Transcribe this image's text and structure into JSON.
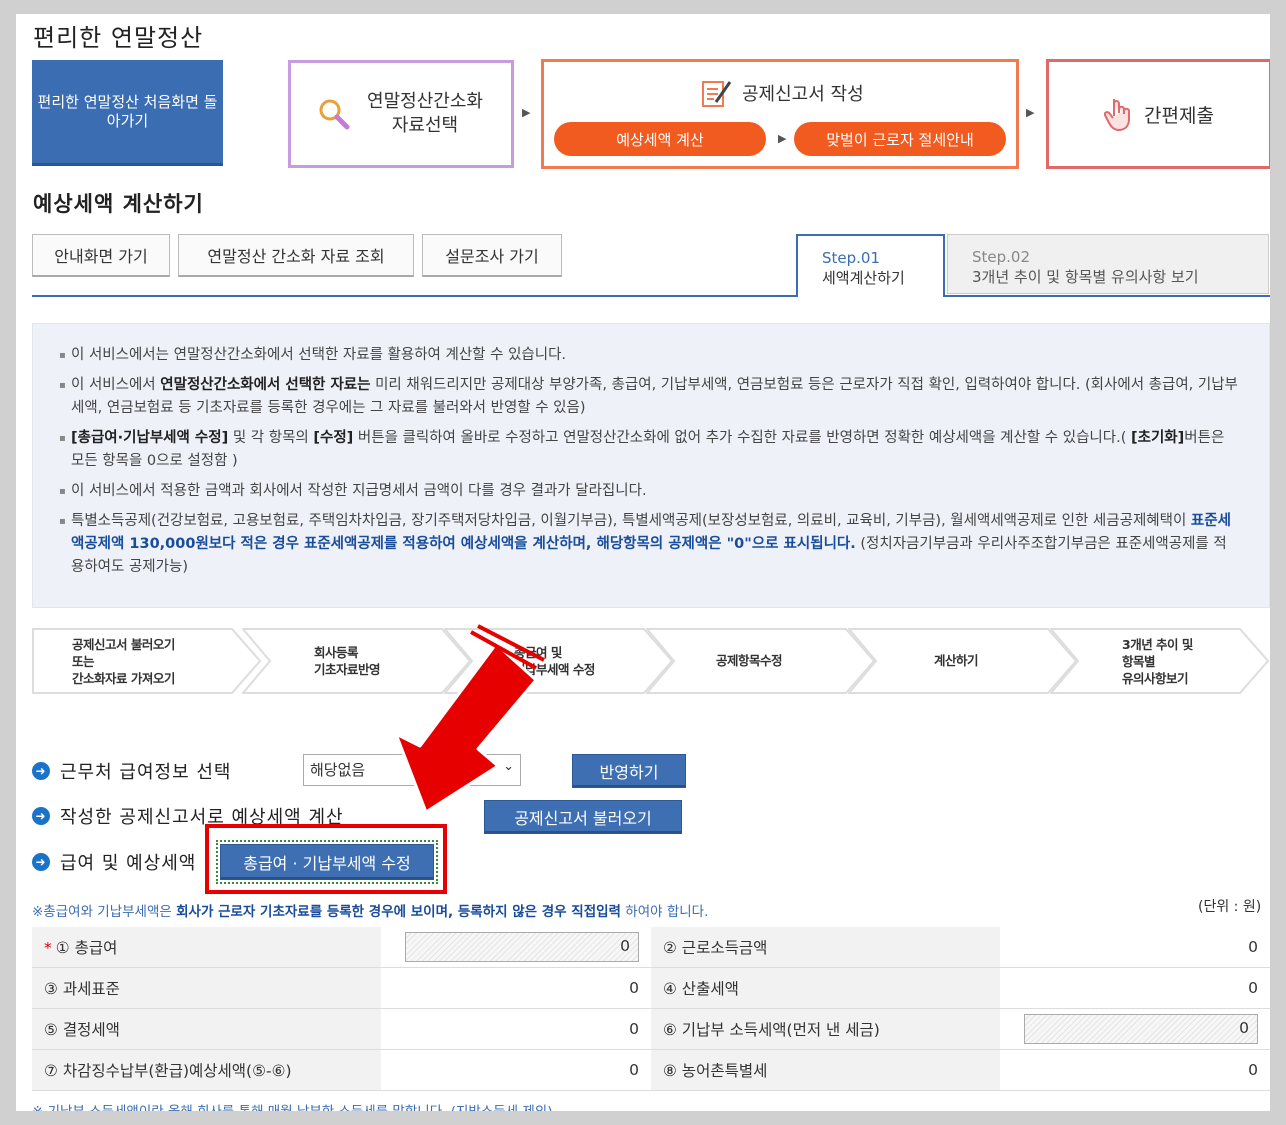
{
  "page": {
    "title": "편리한 연말정산"
  },
  "header": {
    "home_button": "편리한 연말정산 처음화면 돌아가기",
    "step1_label": "연말정산간소화 자료선택",
    "step2_label": "공제신고서 작성",
    "step2_sub1": "예상세액 계산",
    "step2_sub2": "맞벌이 근로자 절세안내",
    "step3_label": "간편제출"
  },
  "section": {
    "title": "예상세액 계산하기"
  },
  "buttons": {
    "guide": "안내화면 가기",
    "lookup": "연말정산 간소화 자료 조회",
    "survey": "설문조사 가기"
  },
  "tabs": [
    {
      "step": "Step.01",
      "label": "세액계산하기"
    },
    {
      "step": "Step.02",
      "label": "3개년 추이 및 항목별 유의사항 보기"
    }
  ],
  "info": {
    "l1": "이 서비스에서는 연말정산간소화에서 선택한 자료를 활용하여 계산할 수 있습니다.",
    "l2a": "이 서비스에서 ",
    "l2b": "연말정산간소화에서 선택한 자료는",
    "l2c": " 미리 채워드리지만 공제대상 부양가족, 총급여, 기납부세액, 연금보험료 등은 근로자가 직접 확인, 입력하여야 합니다. (회사에서 총급여, 기납부세액, 연금보험료 등 기초자료를 등록한 경우에는 그 자료를 불러와서 반영할 수 있음)",
    "l3a": "[총급여·기납부세액 수정]",
    "l3b": " 및 각 항목의 ",
    "l3c": "[수정]",
    "l3d": " 버튼을 클릭하여 올바로 수정하고 연말정산간소화에 없어 추가 수집한 자료를 반영하면 정확한 예상세액을 계산할 수 있습니다.( ",
    "l3e": "[초기화]",
    "l3f": "버튼은 모든 항목을 0으로 설정함 )",
    "l4": "이 서비스에서 적용한 금액과 회사에서 작성한 지급명세서 금액이 다를 경우 결과가 달라집니다.",
    "l5a": "특별소득공제(건강보험료, 고용보험료, 주택임차차입금, 장기주택저당차입금, 이월기부금), 특별세액공제(보장성보험료, 의료비, 교육비, 기부금), 월세액세액공제로 인한 세금공제혜택이 ",
    "l5b": "표준세액공제액 130,000원보다 적은 경우 표준세액공제를 적용하여 예상세액을 계산하며, 해당항목의 공제액은 \"0\"으로 표시됩니다.",
    "l5c": " (정치자금기부금과 우리사주조합기부금은 표준세액공제를 적용하여도 공제가능)"
  },
  "flow": [
    "공제신고서 불러오기\n또는\n간소화자료 가져오기",
    "회사등록\n기초자료반영",
    "총급여 및\n기납부세액 수정",
    "공제항목수정",
    "계산하기",
    "3개년 추이 및\n항목별\n유의사항보기"
  ],
  "rows": {
    "r1_label": "근무처 급여정보 선택",
    "r1_select": "해당없음",
    "r1_button": "반영하기",
    "r2_label": "작성한 공제신고서로 예상세액 계산",
    "r2_button": "공제신고서 불러오기",
    "r3_label": "급여 및 예상세액",
    "r3_button": "총급여 · 기납부세액 수정"
  },
  "note": {
    "a": "※총급여와 기납부세액은 ",
    "b": "회사가 근로자 기초자료를 등록한 경우에 보이며, 등록하지 않은 경우 직접입력",
    "c": " 하여야 합니다.",
    "unit": "(단위 : 원)",
    "bottom": "※ 기납부 소득세액이란 올해 회사를 통해 매월 납부한 소득세를 말합니다. (지방소득세 제외)"
  },
  "table": [
    {
      "l1": "① 총급여",
      "v1": "0",
      "l2": "② 근로소득금액",
      "v2": "0"
    },
    {
      "l1": "③ 과세표준",
      "v1": "0",
      "l2": "④ 산출세액",
      "v2": "0"
    },
    {
      "l1": "⑤ 결정세액",
      "v1": "0",
      "l2": "⑥ 기납부 소득세액(먼저 낸 세금)",
      "v2": "0"
    },
    {
      "l1": "⑦ 차감징수납부(환급)예상세액(⑤-⑥)",
      "v1": "0",
      "l2": "⑧ 농어촌특별세",
      "v2": "0"
    }
  ],
  "colors": {
    "accent": "#3b6db3",
    "orange": "#f25b1f",
    "highlight": "#e60000"
  }
}
